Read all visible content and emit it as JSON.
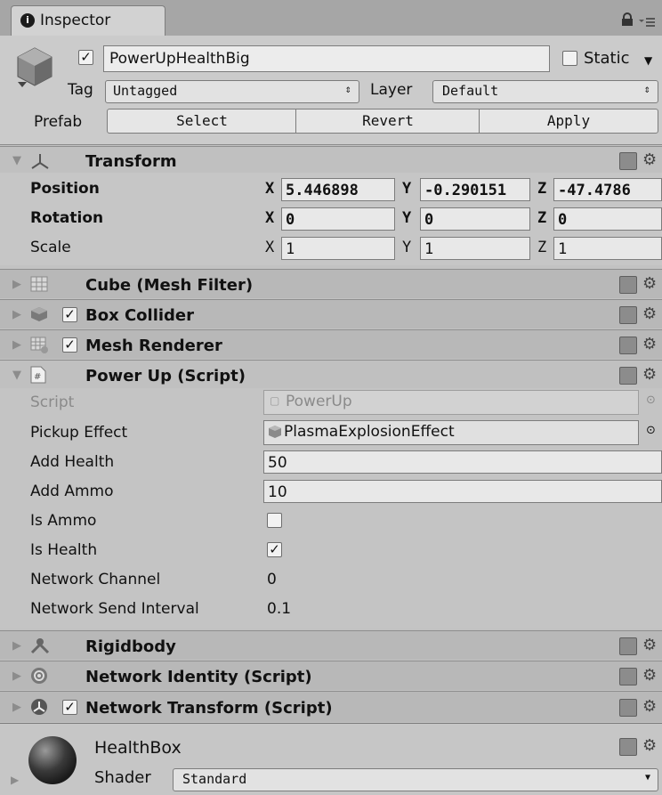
{
  "tab": {
    "title": "Inspector"
  },
  "object": {
    "name": "PowerUpHealthBig",
    "active": true,
    "static_label": "Static",
    "static": false,
    "tag_label": "Tag",
    "tag_value": "Untagged",
    "layer_label": "Layer",
    "layer_value": "Default",
    "prefab_label": "Prefab",
    "prefab_buttons": [
      "Select",
      "Revert",
      "Apply"
    ]
  },
  "transform": {
    "title": "Transform",
    "rows": [
      {
        "label": "Position",
        "x": "5.446898",
        "y": "-0.290151",
        "z": "-47.4786"
      },
      {
        "label": "Rotation",
        "x": "0",
        "y": "0",
        "z": "0"
      },
      {
        "label": "Scale",
        "x": "1",
        "y": "1",
        "z": "1"
      }
    ],
    "axes": [
      "X",
      "Y",
      "Z"
    ]
  },
  "components": {
    "mesh_filter": "Cube (Mesh Filter)",
    "box_collider": "Box Collider",
    "mesh_renderer": "Mesh Renderer",
    "power_up": "Power Up (Script)",
    "rigidbody": "Rigidbody",
    "network_identity": "Network Identity (Script)",
    "network_transform": "Network Transform (Script)"
  },
  "power_up": {
    "script_label": "Script",
    "script_value": "PowerUp",
    "pickup_label": "Pickup Effect",
    "pickup_value": "PlasmaExplosionEffect",
    "add_health_label": "Add Health",
    "add_health_value": "50",
    "add_ammo_label": "Add Ammo",
    "add_ammo_value": "10",
    "is_ammo_label": "Is Ammo",
    "is_ammo": false,
    "is_health_label": "Is Health",
    "is_health": true,
    "net_channel_label": "Network Channel",
    "net_channel_value": "0",
    "net_interval_label": "Network Send Interval",
    "net_interval_value": "0.1"
  },
  "material": {
    "name": "HealthBox",
    "shader_label": "Shader",
    "shader_value": "Standard"
  },
  "icons": {
    "info": "info-icon",
    "lock": "lock-icon",
    "menu": "menu-icon",
    "help": "help-book-icon",
    "gear": "gear-icon"
  }
}
